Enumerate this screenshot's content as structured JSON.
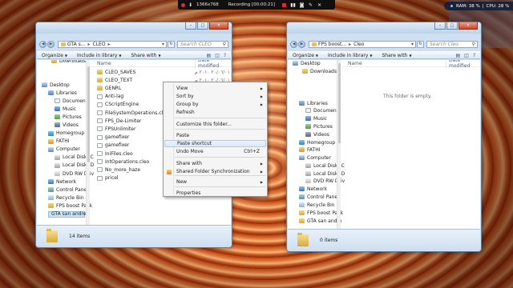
{
  "recording_bar": {
    "resolution": "1366x768",
    "status": "Recording [00:00:21]"
  },
  "system_stats": {
    "ram_label": "RAM: 38 %",
    "cpu_label": "CPU: 28 %"
  },
  "left_window": {
    "address": [
      "GTA s...",
      "CLEO"
    ],
    "search_placeholder": "Search CLEO",
    "toolbar": {
      "organize": "Organize",
      "include": "Include in library",
      "share": "Share with"
    },
    "nav_items": [
      {
        "label": "Downloads",
        "icon": "folder-icon"
      },
      {
        "label": "Libraries",
        "icon": "library-icon"
      },
      {
        "label": "Documents",
        "icon": "documents-icon"
      },
      {
        "label": "Music",
        "icon": "music-icon"
      },
      {
        "label": "Pictures",
        "icon": "pictures-icon"
      },
      {
        "label": "Videos",
        "icon": "videos-icon"
      },
      {
        "label": "Homegroup",
        "icon": "homegroup-icon"
      },
      {
        "label": "FATHI",
        "icon": "user-icon"
      },
      {
        "label": "Computer",
        "icon": "computer-icon"
      },
      {
        "label": "Local Disk (C",
        "icon": "disk-icon"
      },
      {
        "label": "Local Disk (D",
        "icon": "disk-icon"
      },
      {
        "label": "DVD RW Driv",
        "icon": "dvd-icon"
      },
      {
        "label": "Network",
        "icon": "network-icon"
      },
      {
        "label": "Control Panel",
        "icon": "control-panel-icon"
      },
      {
        "label": "Recycle Bin",
        "icon": "recycle-bin-icon"
      },
      {
        "label": "FPS boost Pack",
        "icon": "folder-icon"
      },
      {
        "label": "GTA san andre",
        "icon": "folder-icon"
      }
    ],
    "desktop_label": "Desktop",
    "columns": {
      "name": "Name",
      "date": "Date modified"
    },
    "files": [
      {
        "name": "CLEO_SAVES",
        "type": "folder",
        "date": "٢٠/٠٦/٠١ ٢٠١٠ م"
      },
      {
        "name": "CLEO_TEXT",
        "type": "folder",
        "date": "٢٠/٠٦/٠١ ٢٠١٠ م"
      },
      {
        "name": "GENRL",
        "type": "folder",
        "date": ""
      },
      {
        "name": "Anti-lag",
        "type": "file",
        "date": ""
      },
      {
        "name": "CScriptEngine",
        "type": "file",
        "date": ""
      },
      {
        "name": "FileSystemOperations.cleo",
        "type": "file",
        "date": ""
      },
      {
        "name": "FPS_De-Limiter",
        "type": "file",
        "date": ""
      },
      {
        "name": "FPSUnlimiter",
        "type": "file",
        "date": ""
      },
      {
        "name": "gamefixer",
        "type": "file",
        "date": ""
      },
      {
        "name": "gamefixer",
        "type": "file",
        "date": ""
      },
      {
        "name": "IniFiles.cleo",
        "type": "file",
        "date": ""
      },
      {
        "name": "IntOperations.cleo",
        "type": "file",
        "date": ""
      },
      {
        "name": "No_more_haze",
        "type": "file",
        "date": ""
      },
      {
        "name": "pricel",
        "type": "file",
        "date": ""
      }
    ],
    "item_count": "14 items"
  },
  "right_window": {
    "address": [
      "FPS boost...",
      "Cleo"
    ],
    "search_placeholder": "Search Cleo",
    "toolbar": {
      "organize": "Organize",
      "include": "Include in library",
      "share": "Share with"
    },
    "desktop_label": "Desktop",
    "nav_items": [
      {
        "label": "Downloads",
        "icon": "folder-icon"
      },
      {
        "label": "Libraries",
        "icon": "library-icon"
      },
      {
        "label": "Documents",
        "icon": "documents-icon"
      },
      {
        "label": "Music",
        "icon": "music-icon"
      },
      {
        "label": "Pictures",
        "icon": "pictures-icon"
      },
      {
        "label": "Videos",
        "icon": "videos-icon"
      },
      {
        "label": "Homegroup",
        "icon": "homegroup-icon"
      },
      {
        "label": "FATHI",
        "icon": "user-icon"
      },
      {
        "label": "Computer",
        "icon": "computer-icon"
      },
      {
        "label": "Local Disk (C",
        "icon": "disk-icon"
      },
      {
        "label": "Local Disk (D",
        "icon": "disk-icon"
      },
      {
        "label": "DVD RW Driv",
        "icon": "dvd-icon"
      },
      {
        "label": "Network",
        "icon": "network-icon"
      },
      {
        "label": "Control Panel",
        "icon": "control-panel-icon"
      },
      {
        "label": "Recycle Bin",
        "icon": "recycle-bin-icon"
      },
      {
        "label": "FPS boost Pack",
        "icon": "folder-icon"
      },
      {
        "label": "GTA san andre",
        "icon": "folder-icon"
      }
    ],
    "columns": {
      "name": "Name",
      "date": "Date modified"
    },
    "empty_message": "This folder is empty.",
    "item_count": "0 items"
  },
  "context_menu": {
    "items": [
      {
        "label": "View",
        "submenu": true
      },
      {
        "label": "Sort by",
        "submenu": true
      },
      {
        "label": "Group by",
        "submenu": true
      },
      {
        "label": "Refresh"
      },
      {
        "label": "Customize this folder..."
      },
      {
        "label": "Paste"
      },
      {
        "label": "Paste shortcut",
        "highlighted": true
      },
      {
        "label": "Undo Move",
        "shortcut": "Ctrl+Z"
      },
      {
        "label": "Share with",
        "submenu": true
      },
      {
        "label": "Shared Folder Synchronization",
        "submenu": true
      },
      {
        "label": "New",
        "submenu": true
      },
      {
        "label": "Properties"
      }
    ]
  }
}
